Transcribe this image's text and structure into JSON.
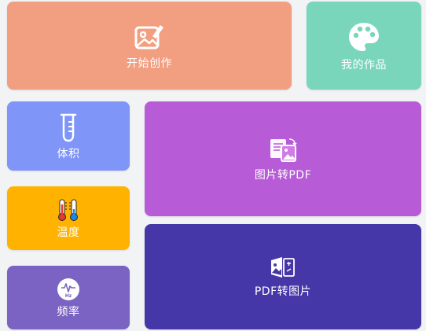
{
  "colors": {
    "create": "#f29e80",
    "works": "#79d6bb",
    "volume": "#7f95f7",
    "temperature": "#ffb300",
    "frequency": "#7a63c2",
    "image_to_pdf": "#b75bd6",
    "pdf_to_image": "#4537a8"
  },
  "tiles": {
    "create": {
      "label": "开始创作",
      "icon": "image-edit-icon"
    },
    "works": {
      "label": "我的作品",
      "icon": "palette-icon"
    },
    "volume": {
      "label": "体积",
      "icon": "test-tube-icon"
    },
    "temperature": {
      "label": "温度",
      "icon": "thermometer-icon"
    },
    "frequency": {
      "label": "频率",
      "icon": "frequency-hz-icon"
    },
    "image_to_pdf": {
      "label": "图片转PDF",
      "icon": "image-to-pdf-icon"
    },
    "pdf_to_image": {
      "label": "PDF转图片",
      "icon": "pdf-to-image-icon"
    }
  }
}
